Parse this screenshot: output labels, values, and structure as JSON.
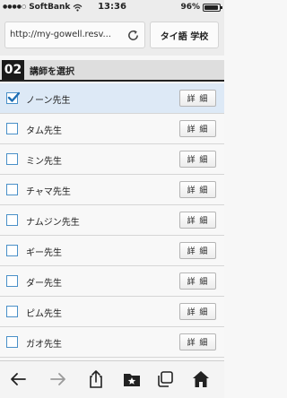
{
  "status_bar": {
    "signal": "●●●●○",
    "carrier": "SoftBank",
    "time": "13:36",
    "battery_percent": "96%",
    "battery_level": 0.96
  },
  "toolbar": {
    "url": "http://my-gowell.resv...",
    "language_button": "タイ語 学校"
  },
  "section": {
    "number": "02",
    "title": "講師を選択"
  },
  "teachers": [
    {
      "name": "ノーン先生",
      "selected": true,
      "detail_label": "詳 細"
    },
    {
      "name": "タム先生",
      "selected": false,
      "detail_label": "詳 細"
    },
    {
      "name": "ミン先生",
      "selected": false,
      "detail_label": "詳 細"
    },
    {
      "name": "チャマ先生",
      "selected": false,
      "detail_label": "詳 細"
    },
    {
      "name": "ナムジン先生",
      "selected": false,
      "detail_label": "詳 細"
    },
    {
      "name": "ギー先生",
      "selected": false,
      "detail_label": "詳 細"
    },
    {
      "name": "ダー先生",
      "selected": false,
      "detail_label": "詳 細"
    },
    {
      "name": "ピム先生",
      "selected": false,
      "detail_label": "詳 細"
    },
    {
      "name": "ガオ先生",
      "selected": false,
      "detail_label": "詳 細"
    }
  ],
  "bottom_bar": {
    "icons": [
      "back-arrow-icon",
      "forward-arrow-icon",
      "share-icon",
      "bookmarks-folder-icon",
      "tabs-icon",
      "home-icon"
    ]
  },
  "colors": {
    "selected_row": "#dde9f6",
    "checkbox_border": "#4a90c8",
    "section_number_bg": "#1a1a1a",
    "toolbar_bg": "#ececec"
  }
}
